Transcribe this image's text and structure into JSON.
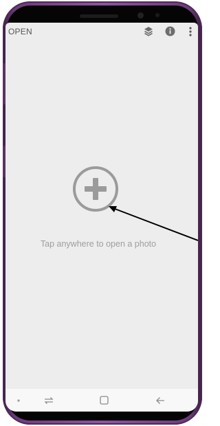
{
  "toolbar": {
    "open_label": "OPEN",
    "icons": [
      "layers-icon",
      "info-icon",
      "more-vert-icon"
    ]
  },
  "main": {
    "add_icon": "add-photo-icon",
    "hint_text": "Tap anywhere to open a photo"
  },
  "navbar": {
    "items": [
      "recents-icon",
      "home-icon",
      "back-icon"
    ]
  },
  "colors": {
    "screen_bg": "#ededed",
    "plus_icon": "#9b9b9b",
    "hint_text": "#9e9e9e",
    "phone_frame": "#8e55a0",
    "annotation_arrow": "#000000"
  }
}
